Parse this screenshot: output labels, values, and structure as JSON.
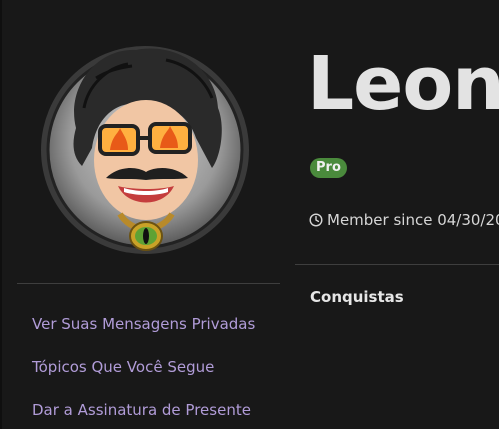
{
  "profile": {
    "username": "Leon",
    "badge": "Pro",
    "member_since": "Member since 04/30/20",
    "clock_icon": "clock-icon",
    "avatar_icon": "avatar-illustration"
  },
  "sidebar": {
    "links": [
      {
        "label": "Ver Suas Mensagens Privadas"
      },
      {
        "label": "Tópicos Que Você Segue"
      },
      {
        "label": "Dar a Assinatura de Presente"
      }
    ]
  },
  "main": {
    "section_title": "Conquistas"
  },
  "colors": {
    "background": "#181818",
    "link": "#b19cd8",
    "badge": "#4a8a3c",
    "username": "#e3e3e3"
  }
}
